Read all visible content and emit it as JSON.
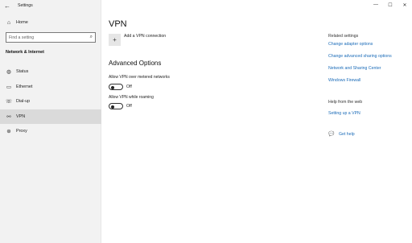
{
  "window": {
    "title": "Settings",
    "controls": [
      "—",
      "☐",
      "✕"
    ]
  },
  "sidebar": {
    "back_icon": "←",
    "home": {
      "label": "Home",
      "icon": "⌂"
    },
    "search": {
      "placeholder": "Find a setting",
      "icon": "⌕"
    },
    "section": "Network & Internet",
    "items": [
      {
        "label": "Status",
        "icon": "◍",
        "active": false
      },
      {
        "label": "Ethernet",
        "icon": "▭",
        "active": false
      },
      {
        "label": "Dial-up",
        "icon": "☏",
        "active": false
      },
      {
        "label": "VPN",
        "icon": "⚯",
        "active": true
      },
      {
        "label": "Proxy",
        "icon": "⊕",
        "active": false
      }
    ]
  },
  "main": {
    "title": "VPN",
    "add_vpn": {
      "icon": "+",
      "label": "Add a VPN connection"
    },
    "advanced_title": "Advanced Options",
    "options": [
      {
        "label": "Allow VPN over metered networks",
        "state": "Off"
      },
      {
        "label": "Allow VPN while roaming",
        "state": "Off"
      }
    ]
  },
  "related": {
    "heading": "Related settings",
    "links": [
      "Change adapter options",
      "Change advanced sharing options",
      "Network and Sharing Center",
      "Windows Firewall"
    ],
    "help_heading": "Help from the web",
    "help_links": [
      "Setting up a VPN"
    ],
    "get_help": {
      "icon": "💬",
      "label": "Get help"
    }
  }
}
